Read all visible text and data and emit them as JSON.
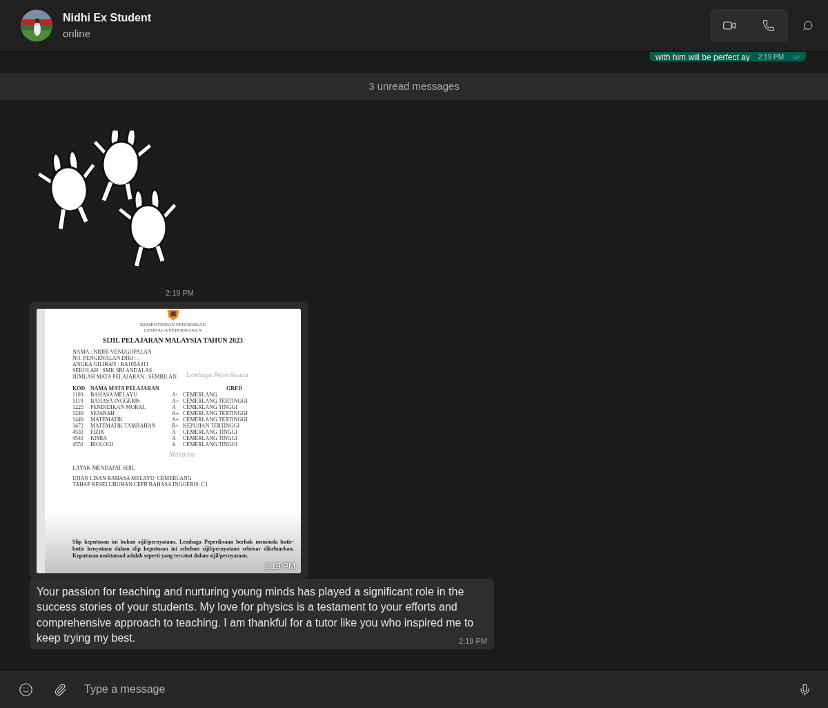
{
  "contact": {
    "name": "Nidhi Ex Student",
    "status": "online"
  },
  "messages": [
    {
      "kind": "outgoing",
      "text": "with him will be perfect ay",
      "time": "2:19 PM",
      "read": true
    },
    {
      "kind": "divider",
      "text": "3 unread messages"
    },
    {
      "kind": "sticker",
      "time": "2:19 PM"
    },
    {
      "kind": "document",
      "time": "2:19 PM",
      "document": {
        "agency_lines": [
          "KEMENTERIAN PENDIDIKAN",
          "LEMBAGA PEPERIKSAAN"
        ],
        "title": "SIJIL PELAJARAN MALAYSIA TAHUN 2023",
        "fields": [
          "NAMA : NIDHI VENUGOPALAN",
          "NO. PENGENALAN DIRI : ,",
          "ANGKA GILIRAN : BA105A011",
          "SEKOLAH : SMK SRI ANDALAS",
          "JUMLAH MATA PELAJARAN : SEMBILAN"
        ],
        "seal_text": [
          "Lembaga Peperiksaan",
          "Malaysia"
        ],
        "columns": [
          "KOD",
          "NAMA MATA PELAJARAN",
          "GRED"
        ],
        "rows": [
          {
            "code": "1103",
            "subject": "BAHASA MELAYU",
            "grade": "A-",
            "remark": "CEMERLANG"
          },
          {
            "code": "1119",
            "subject": "BAHASA INGGERIS",
            "grade": "A+",
            "remark": "CEMERLANG TERTINGGI"
          },
          {
            "code": "1225",
            "subject": "PENDIDIKAN MORAL",
            "grade": "A",
            "remark": "CEMERLANG TINGGI"
          },
          {
            "code": "1249",
            "subject": "SEJARAH",
            "grade": "A+",
            "remark": "CEMERLANG TERTINGGI"
          },
          {
            "code": "1449",
            "subject": "MATEMATIK",
            "grade": "A+",
            "remark": "CEMERLANG TERTINGGI"
          },
          {
            "code": "3472",
            "subject": "MATEMATIK TAMBAHAN",
            "grade": "B+",
            "remark": "KEPUJIAN TERTINGGI"
          },
          {
            "code": "4531",
            "subject": "FIZIK",
            "grade": "A",
            "remark": "CEMERLANG TINGGI"
          },
          {
            "code": "4541",
            "subject": "KIMIA",
            "grade": "A",
            "remark": "CEMERLANG TINGGI"
          },
          {
            "code": "4551",
            "subject": "BIOLOGI",
            "grade": "A",
            "remark": "CEMERLANG TINGGI"
          }
        ],
        "result": "LAYAK MENDAPAT SIJIL",
        "notes": [
          "UJIAN LISAN BAHASA MELAYU: CEMERLANG",
          "TAHAP KESELURUHAN CEFR BAHASA INGGERIS: C1"
        ],
        "disclaimer": "Slip keputusan ini bukan sijil/pernyataan. Lembaga Peperiksaan berhak meminda butir-butir kenyataan dalam slip keputusan ini sebelum sijil/pernyataan sebenar dikeluarkan. Keputusan muktamad adalah seperti yang tercatat dalam sijil/pernyataan."
      }
    },
    {
      "kind": "incoming",
      "text": "Your passion for teaching and nurturing young minds has played a significant role in the success stories of your students. My love for physics is a testament to your efforts and comprehensive approach to teaching. I am thankful for a tutor like you who inspired me to keep trying my best.",
      "time": "2:19 PM"
    }
  ],
  "composer": {
    "placeholder": "Type a message"
  }
}
